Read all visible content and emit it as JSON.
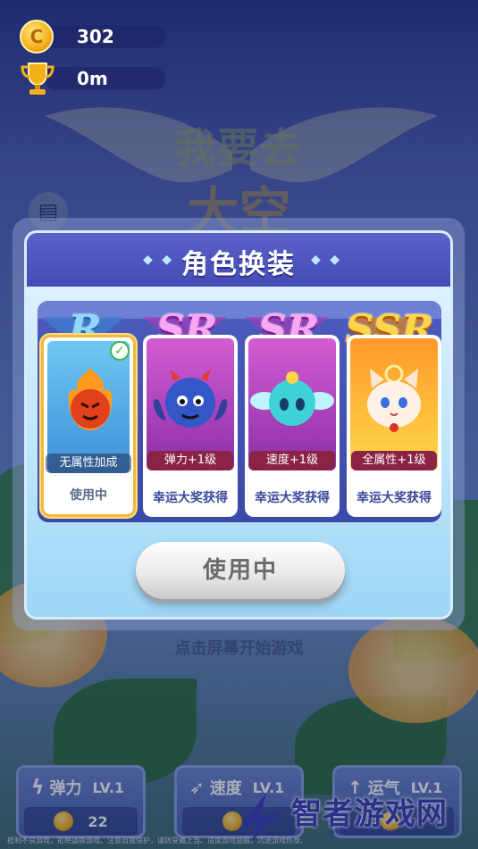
{
  "hud": {
    "coins": "302",
    "distance": "0m",
    "coin_icon_glyph": "C"
  },
  "background": {
    "title_line1": "我要去",
    "title_line2": "大空",
    "hint": "点击屏幕开始游戏"
  },
  "modal": {
    "title": "角色换装",
    "title_dots_left": "◆ ◆",
    "title_dots_right": "◆ ◆",
    "use_button_label": "使用中"
  },
  "cards": [
    {
      "rarity": "R",
      "attribute": "无属性加成",
      "status": "使用中",
      "selected": true,
      "character": "fire-character"
    },
    {
      "rarity": "SR",
      "attribute": "弹力+1级",
      "status": "幸运大奖获得",
      "selected": false,
      "character": "blue-devil-character"
    },
    {
      "rarity": "SR",
      "attribute": "速度+1级",
      "status": "幸运大奖获得",
      "selected": false,
      "character": "cyan-winged-character"
    },
    {
      "rarity": "SSR",
      "attribute": "全属性+1级",
      "status": "幸运大奖获得",
      "selected": false,
      "character": "cat-character"
    }
  ],
  "upgrades": [
    {
      "label": "弹力",
      "level": "LV.1",
      "cost": "22",
      "icon": "lightning-icon"
    },
    {
      "label": "速度",
      "level": "LV.1",
      "cost": "",
      "icon": "speed-icon"
    },
    {
      "label": "运气",
      "level": "LV.1",
      "cost": "",
      "icon": "luck-icon"
    }
  ],
  "watermark": {
    "text": "智者游戏网",
    "url": "www.znzmo.com"
  },
  "footer": "抵制不良游戏，拒绝盗版游戏。注意自我保护，谨防受骗上当。适度游戏益脑，沉迷游戏伤身。",
  "colors": {
    "modal_header": "#4f57c0",
    "selected_border": "#f4b73b",
    "r_card": "#4aa6e3",
    "sr_card": "#b046c2",
    "ssr_card": "#ffb534",
    "check_green": "#3db64a"
  }
}
